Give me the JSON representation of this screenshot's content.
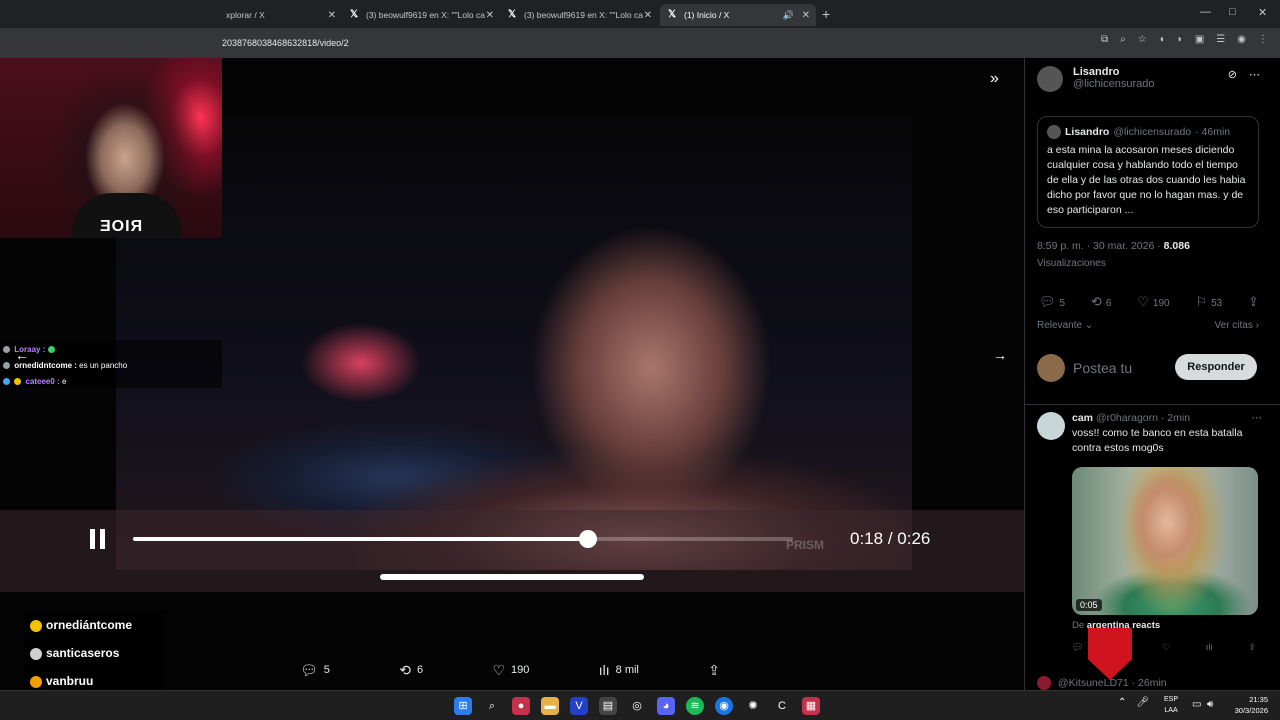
{
  "browser": {
    "tabs": [
      {
        "title": "xplorar / X"
      },
      {
        "title": "(3) beowulf9619 en X: \"\"Lolo ca"
      },
      {
        "title": "(3) beowulf9619 en X: \"\"Lolo ca"
      },
      {
        "title": "(1) Inicio / X"
      }
    ],
    "new_tab": "+",
    "url": "2038768038468632818/video/2",
    "window_controls": {
      "minimize": "—",
      "maximize": "□",
      "close": "✕"
    }
  },
  "stream_overlay": {
    "webcam_text": "ƎOIЯ",
    "chat": [
      {
        "user": "Loraay :",
        "msg": "",
        "color": "#b782ff",
        "emote": "#3bd16f"
      },
      {
        "user": "ornedidntcome :",
        "msg": "es un pancho",
        "color": "#ffffff",
        "emote": ""
      },
      {
        "user": "cateee0 :",
        "msg": "e",
        "color": "#b782ff",
        "emote": ""
      }
    ],
    "alerts": [
      {
        "name": "ornediántcome",
        "color": "#f2c200"
      },
      {
        "name": "santicaseros",
        "color": "#d0d0d0"
      },
      {
        "name": "vanbruu",
        "color": "#f2a000"
      }
    ]
  },
  "video": {
    "current_time": "0:18",
    "separator": " / ",
    "duration": "0:26",
    "progress": 0.69,
    "watermark": "PRISM"
  },
  "media_actions": {
    "replies": "5",
    "reposts": "6",
    "likes": "190",
    "views": "8 mil"
  },
  "sidebar": {
    "author": {
      "name": "Lisandro",
      "handle": "@lichicensurado"
    },
    "quote": {
      "name": "Lisandro",
      "handle": "@lichicensurado",
      "time": "· 46min",
      "text": "a esta mina la acosaron meses diciendo cualquier cosa y hablando todo el tiempo de ella y de las otras dos cuando les habia dicho por favor que no lo hagan mas. y de eso participaron ..."
    },
    "timestamp": "8:59 p. m. · 30 mar. 2026 ·",
    "views_count": "8.086",
    "views_label": "Visualizaciones",
    "stats": {
      "replies": "5",
      "reposts": "6",
      "likes": "190",
      "bookmarks": "53"
    },
    "sort_label": "Relevante",
    "quotes_link": "Ver citas",
    "reply_placeholder": "Postea tu",
    "reply_button": "Responder",
    "reply": {
      "name": "cam",
      "handle": "@r0haragorn",
      "time": "· 2min",
      "text": "voss!! como te banco en esta batalla contra estos mog0s",
      "thumb_time": "0:05",
      "from_prefix": "De",
      "from_source": "argentina reacts"
    },
    "next_reply": "@KitsuneLD71 · 26min"
  },
  "taskbar": {
    "lang_line1": "ESP",
    "lang_line2": "LAA",
    "time": "21:35",
    "date": "30/3/2026"
  }
}
